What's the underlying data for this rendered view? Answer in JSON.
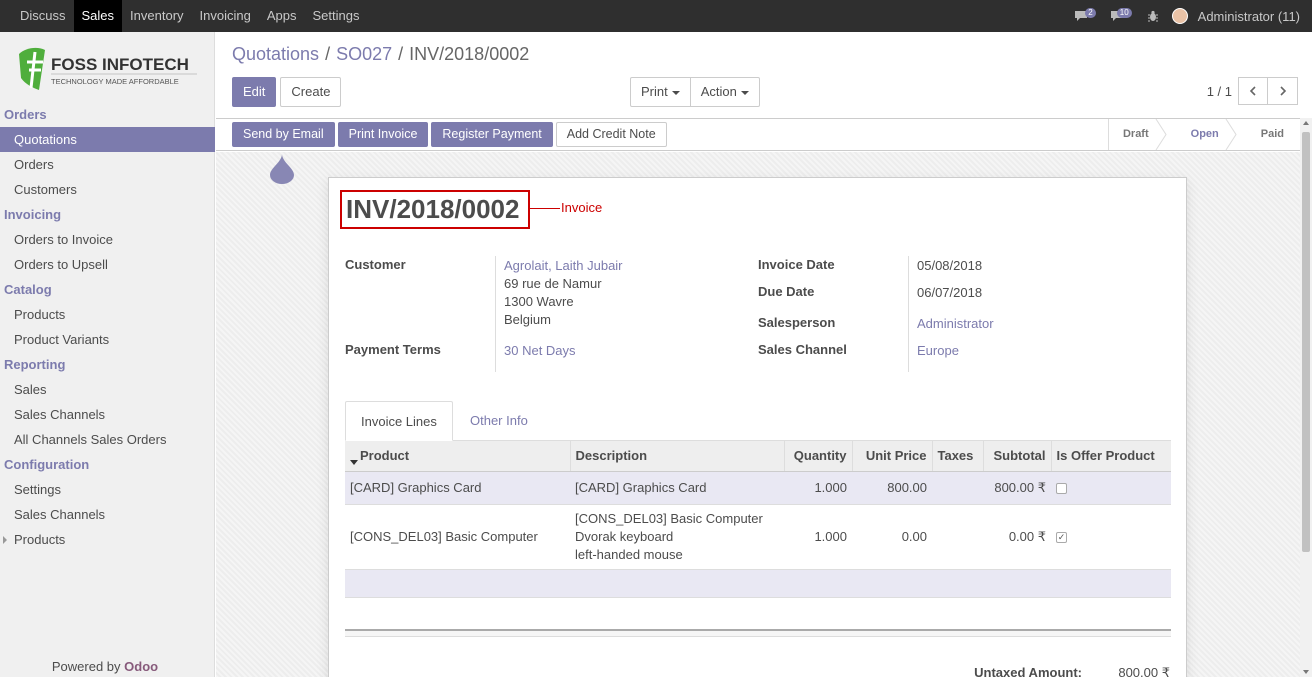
{
  "topbar": {
    "menu": [
      "Discuss",
      "Sales",
      "Inventory",
      "Invoicing",
      "Apps",
      "Settings"
    ],
    "active_menu": "Sales",
    "chat_badge": "2",
    "messages_badge": "10",
    "user": "Administrator (11)",
    "icons": [
      "chat-icon",
      "messages-icon",
      "bug-icon",
      "avatar"
    ]
  },
  "sidebar": {
    "logo": {
      "name": "FOSS INFOTECH",
      "tagline": "TECHNOLOGY MADE AFFORDABLE"
    },
    "sections": [
      {
        "title": "Orders",
        "items": [
          "Quotations",
          "Orders",
          "Customers"
        ]
      },
      {
        "title": "Invoicing",
        "items": [
          "Orders to Invoice",
          "Orders to Upsell"
        ]
      },
      {
        "title": "Catalog",
        "items": [
          "Products",
          "Product Variants"
        ]
      },
      {
        "title": "Reporting",
        "items": [
          "Sales",
          "Sales Channels",
          "All Channels Sales Orders"
        ]
      },
      {
        "title": "Configuration",
        "items": [
          "Settings",
          "Sales Channels",
          "Products"
        ]
      }
    ],
    "active_item": "Quotations",
    "powered_by": "Powered by",
    "powered_brand": "Odoo"
  },
  "breadcrumb": {
    "items": [
      "Quotations",
      "SO027"
    ],
    "separator": "/",
    "current": "INV/2018/0002"
  },
  "buttons": {
    "edit": "Edit",
    "create": "Create",
    "print": "Print",
    "action": "Action"
  },
  "pager": {
    "value": "1 / 1"
  },
  "status_actions": [
    "Send by Email",
    "Print Invoice",
    "Register Payment",
    "Add Credit Note"
  ],
  "stages": [
    "Draft",
    "Open",
    "Paid"
  ],
  "active_stage": "Open",
  "invoice": {
    "number": "INV/2018/0002",
    "annotation": "Invoice",
    "customer_label": "Customer",
    "customer_name": "Agrolait, Laith Jubair",
    "customer_address": [
      "69 rue de Namur",
      "1300 Wavre",
      "Belgium"
    ],
    "payment_terms_label": "Payment Terms",
    "payment_terms": "30 Net Days",
    "invoice_date_label": "Invoice Date",
    "invoice_date": "05/08/2018",
    "due_date_label": "Due Date",
    "due_date": "06/07/2018",
    "salesperson_label": "Salesperson",
    "salesperson": "Administrator",
    "sales_channel_label": "Sales Channel",
    "sales_channel": "Europe"
  },
  "tabs": [
    "Invoice Lines",
    "Other Info"
  ],
  "lines": {
    "headers": [
      "Product",
      "Description",
      "Quantity",
      "Unit Price",
      "Taxes",
      "Subtotal",
      "Is Offer Product"
    ],
    "rows": [
      {
        "product": "[CARD] Graphics Card",
        "description": [
          "[CARD] Graphics Card"
        ],
        "quantity": "1.000",
        "unit_price": "800.00",
        "taxes": "",
        "subtotal": "800.00 ₹",
        "offer": false
      },
      {
        "product": "[CONS_DEL03] Basic Computer",
        "description": [
          "[CONS_DEL03] Basic Computer",
          "Dvorak keyboard",
          "left-handed mouse"
        ],
        "quantity": "1.000",
        "unit_price": "0.00",
        "taxes": "",
        "subtotal": "0.00 ₹",
        "offer": true
      }
    ]
  },
  "totals": {
    "untaxed_label": "Untaxed Amount:",
    "untaxed_value": "800.00 ₹"
  },
  "colors": {
    "accent": "#7c7bad",
    "topbar": "#2f2f2f",
    "annotation": "#cc0000"
  }
}
